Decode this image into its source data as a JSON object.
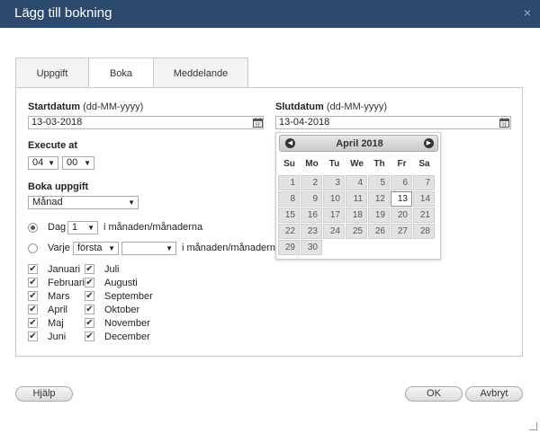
{
  "dialog": {
    "title": "Lägg till bokning",
    "close_glyph": "×"
  },
  "tabs": [
    {
      "label": "Uppgift",
      "active": false
    },
    {
      "label": "Boka",
      "active": true
    },
    {
      "label": "Meddelande",
      "active": false
    }
  ],
  "start": {
    "label": "Startdatum",
    "hint": "(dd-MM-yyyy)",
    "value": "13-03-2018"
  },
  "end": {
    "label": "Slutdatum",
    "hint": "(dd-MM-yyyy)",
    "value": "13-04-2018"
  },
  "execute": {
    "label": "Execute at",
    "hour": "04",
    "minute": "00"
  },
  "book_task": {
    "label": "Boka uppgift",
    "value": "Månad"
  },
  "option_day": {
    "selected": true,
    "label": "Dag",
    "value": "1",
    "suffix": "i månaden/månaderna"
  },
  "option_every": {
    "selected": false,
    "label": "Varje",
    "ordinal": "första",
    "weekday": "",
    "suffix": "i månaden/månaderna"
  },
  "months_left": [
    {
      "name": "Januari",
      "checked": true
    },
    {
      "name": "Februari",
      "checked": true
    },
    {
      "name": "Mars",
      "checked": true
    },
    {
      "name": "April",
      "checked": true
    },
    {
      "name": "Maj",
      "checked": true
    },
    {
      "name": "Juni",
      "checked": true
    }
  ],
  "months_right": [
    {
      "name": "Juli",
      "checked": true
    },
    {
      "name": "Augusti",
      "checked": true
    },
    {
      "name": "September",
      "checked": true
    },
    {
      "name": "Oktober",
      "checked": true
    },
    {
      "name": "November",
      "checked": true
    },
    {
      "name": "December",
      "checked": true
    }
  ],
  "datepicker": {
    "title": "April 2018",
    "prev_glyph": "◀",
    "next_glyph": "▶",
    "weekdays": [
      "Su",
      "Mo",
      "Tu",
      "We",
      "Th",
      "Fr",
      "Sa"
    ],
    "days": [
      "1",
      "2",
      "3",
      "4",
      "5",
      "6",
      "7",
      "8",
      "9",
      "10",
      "11",
      "12",
      "13",
      "14",
      "15",
      "16",
      "17",
      "18",
      "19",
      "20",
      "21",
      "22",
      "23",
      "24",
      "25",
      "26",
      "27",
      "28",
      "29",
      "30"
    ],
    "first_weekday_index": 0,
    "today": "13"
  },
  "buttons": {
    "help": "Hjälp",
    "ok": "OK",
    "cancel": "Avbryt"
  },
  "icons": {
    "calendar": "calendar-icon",
    "check_glyph": "✔",
    "dropdown_glyph": "▼"
  }
}
